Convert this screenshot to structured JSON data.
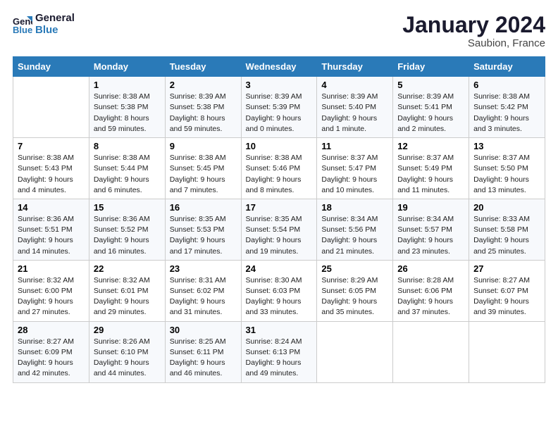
{
  "header": {
    "logo_line1": "General",
    "logo_line2": "Blue",
    "title": "January 2024",
    "subtitle": "Saubion, France"
  },
  "columns": [
    "Sunday",
    "Monday",
    "Tuesday",
    "Wednesday",
    "Thursday",
    "Friday",
    "Saturday"
  ],
  "weeks": [
    [
      {
        "day": "",
        "info": ""
      },
      {
        "day": "1",
        "info": "Sunrise: 8:38 AM\nSunset: 5:38 PM\nDaylight: 8 hours\nand 59 minutes."
      },
      {
        "day": "2",
        "info": "Sunrise: 8:39 AM\nSunset: 5:38 PM\nDaylight: 8 hours\nand 59 minutes."
      },
      {
        "day": "3",
        "info": "Sunrise: 8:39 AM\nSunset: 5:39 PM\nDaylight: 9 hours\nand 0 minutes."
      },
      {
        "day": "4",
        "info": "Sunrise: 8:39 AM\nSunset: 5:40 PM\nDaylight: 9 hours\nand 1 minute."
      },
      {
        "day": "5",
        "info": "Sunrise: 8:39 AM\nSunset: 5:41 PM\nDaylight: 9 hours\nand 2 minutes."
      },
      {
        "day": "6",
        "info": "Sunrise: 8:38 AM\nSunset: 5:42 PM\nDaylight: 9 hours\nand 3 minutes."
      }
    ],
    [
      {
        "day": "7",
        "info": "Sunrise: 8:38 AM\nSunset: 5:43 PM\nDaylight: 9 hours\nand 4 minutes."
      },
      {
        "day": "8",
        "info": "Sunrise: 8:38 AM\nSunset: 5:44 PM\nDaylight: 9 hours\nand 6 minutes."
      },
      {
        "day": "9",
        "info": "Sunrise: 8:38 AM\nSunset: 5:45 PM\nDaylight: 9 hours\nand 7 minutes."
      },
      {
        "day": "10",
        "info": "Sunrise: 8:38 AM\nSunset: 5:46 PM\nDaylight: 9 hours\nand 8 minutes."
      },
      {
        "day": "11",
        "info": "Sunrise: 8:37 AM\nSunset: 5:47 PM\nDaylight: 9 hours\nand 10 minutes."
      },
      {
        "day": "12",
        "info": "Sunrise: 8:37 AM\nSunset: 5:49 PM\nDaylight: 9 hours\nand 11 minutes."
      },
      {
        "day": "13",
        "info": "Sunrise: 8:37 AM\nSunset: 5:50 PM\nDaylight: 9 hours\nand 13 minutes."
      }
    ],
    [
      {
        "day": "14",
        "info": "Sunrise: 8:36 AM\nSunset: 5:51 PM\nDaylight: 9 hours\nand 14 minutes."
      },
      {
        "day": "15",
        "info": "Sunrise: 8:36 AM\nSunset: 5:52 PM\nDaylight: 9 hours\nand 16 minutes."
      },
      {
        "day": "16",
        "info": "Sunrise: 8:35 AM\nSunset: 5:53 PM\nDaylight: 9 hours\nand 17 minutes."
      },
      {
        "day": "17",
        "info": "Sunrise: 8:35 AM\nSunset: 5:54 PM\nDaylight: 9 hours\nand 19 minutes."
      },
      {
        "day": "18",
        "info": "Sunrise: 8:34 AM\nSunset: 5:56 PM\nDaylight: 9 hours\nand 21 minutes."
      },
      {
        "day": "19",
        "info": "Sunrise: 8:34 AM\nSunset: 5:57 PM\nDaylight: 9 hours\nand 23 minutes."
      },
      {
        "day": "20",
        "info": "Sunrise: 8:33 AM\nSunset: 5:58 PM\nDaylight: 9 hours\nand 25 minutes."
      }
    ],
    [
      {
        "day": "21",
        "info": "Sunrise: 8:32 AM\nSunset: 6:00 PM\nDaylight: 9 hours\nand 27 minutes."
      },
      {
        "day": "22",
        "info": "Sunrise: 8:32 AM\nSunset: 6:01 PM\nDaylight: 9 hours\nand 29 minutes."
      },
      {
        "day": "23",
        "info": "Sunrise: 8:31 AM\nSunset: 6:02 PM\nDaylight: 9 hours\nand 31 minutes."
      },
      {
        "day": "24",
        "info": "Sunrise: 8:30 AM\nSunset: 6:03 PM\nDaylight: 9 hours\nand 33 minutes."
      },
      {
        "day": "25",
        "info": "Sunrise: 8:29 AM\nSunset: 6:05 PM\nDaylight: 9 hours\nand 35 minutes."
      },
      {
        "day": "26",
        "info": "Sunrise: 8:28 AM\nSunset: 6:06 PM\nDaylight: 9 hours\nand 37 minutes."
      },
      {
        "day": "27",
        "info": "Sunrise: 8:27 AM\nSunset: 6:07 PM\nDaylight: 9 hours\nand 39 minutes."
      }
    ],
    [
      {
        "day": "28",
        "info": "Sunrise: 8:27 AM\nSunset: 6:09 PM\nDaylight: 9 hours\nand 42 minutes."
      },
      {
        "day": "29",
        "info": "Sunrise: 8:26 AM\nSunset: 6:10 PM\nDaylight: 9 hours\nand 44 minutes."
      },
      {
        "day": "30",
        "info": "Sunrise: 8:25 AM\nSunset: 6:11 PM\nDaylight: 9 hours\nand 46 minutes."
      },
      {
        "day": "31",
        "info": "Sunrise: 8:24 AM\nSunset: 6:13 PM\nDaylight: 9 hours\nand 49 minutes."
      },
      {
        "day": "",
        "info": ""
      },
      {
        "day": "",
        "info": ""
      },
      {
        "day": "",
        "info": ""
      }
    ]
  ]
}
